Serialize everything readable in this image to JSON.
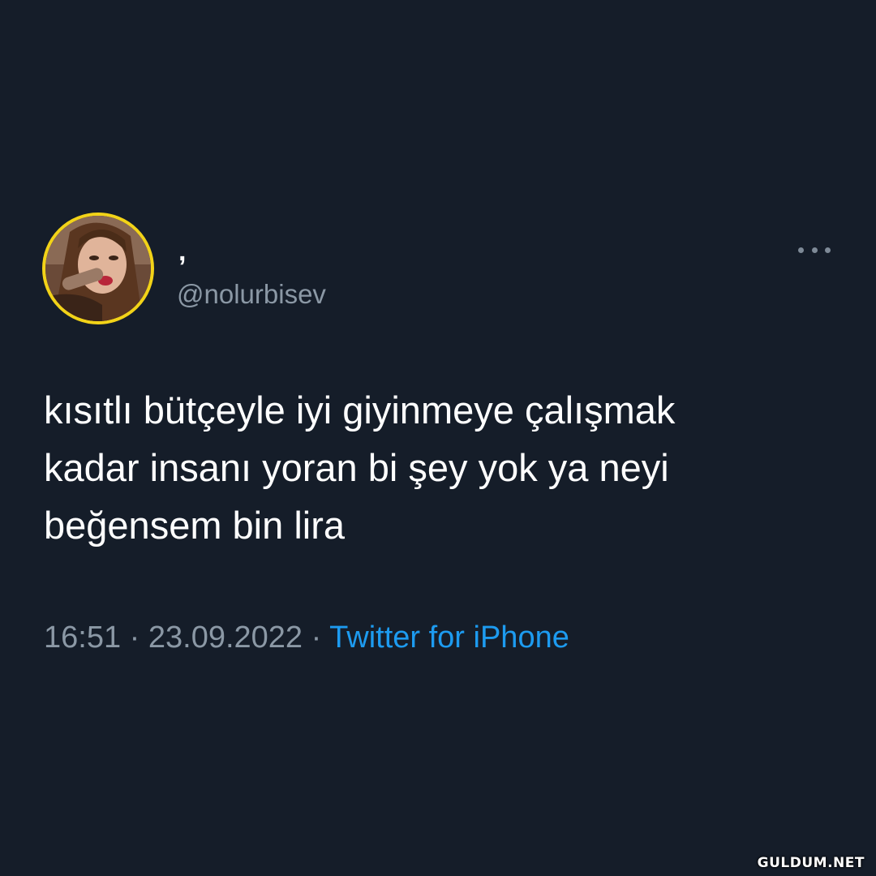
{
  "tweet": {
    "display_name": ",",
    "handle": "@nolurbisev",
    "text": "kısıtlı bütçeyle iyi giyinmeye çalışmak\nkadar insanı yoran bi şey yok ya neyi\nbeğensem bin lira",
    "time": "16:51",
    "separator": "·",
    "date": "23.09.2022",
    "source": "Twitter for iPhone",
    "more_icon": "more-horizontal-icon"
  },
  "watermark": "GULDUM.NET",
  "colors": {
    "background": "#151d29",
    "text": "#ffffff",
    "secondary": "#8b98a5",
    "link": "#1d9bf0",
    "avatar_ring": "#f2d318"
  }
}
